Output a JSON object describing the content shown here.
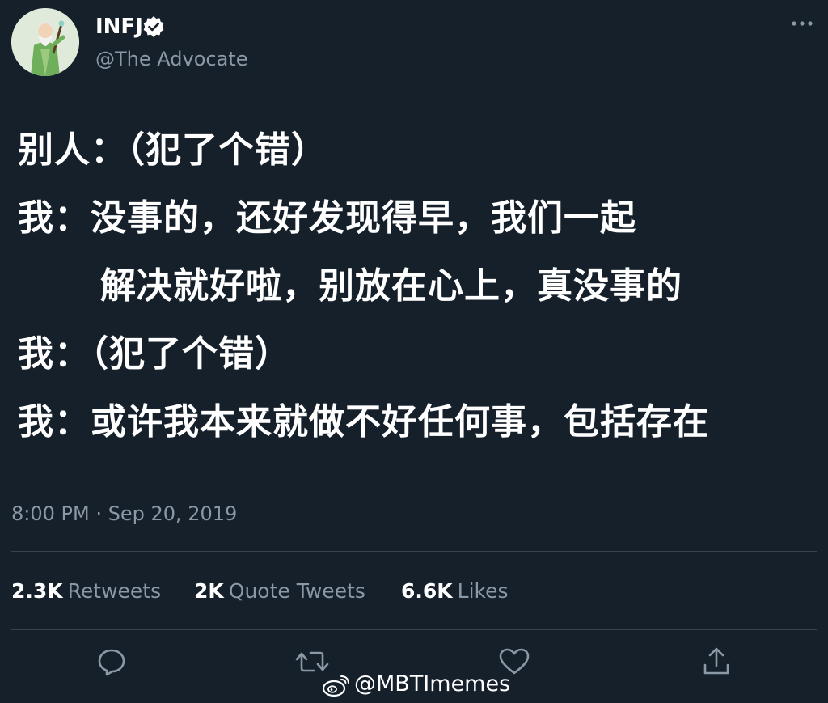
{
  "author": {
    "display_name": "INFJ",
    "handle": "@The Advocate",
    "avatar_icon": "advocate-character-avatar",
    "verified_icon": "verified-badge-icon"
  },
  "tweet": {
    "lines": [
      "别人：（犯了个错）",
      "我：没事的，还好发现得早，我们一起",
      "解决就好啦，别放在心上，真没事的",
      "我：（犯了个错）",
      "我：或许我本来就做不好任何事，包括存在"
    ],
    "timestamp": "8:00 PM · Sep 20, 2019"
  },
  "stats": {
    "retweets_count": "2.3K",
    "retweets_label": "Retweets",
    "quotes_count": "2K",
    "quotes_label": "Quote Tweets",
    "likes_count": "6.6K",
    "likes_label": "Likes"
  },
  "actions": [
    "reply-icon",
    "retweet-icon",
    "like-icon",
    "share-icon"
  ],
  "watermark": {
    "text": "@MBTImemes",
    "icon": "weibo-logo-icon"
  },
  "colors": {
    "background": "#15202b",
    "text_primary": "#ffffff",
    "text_secondary": "#8b98a5",
    "divider": "#38444d"
  }
}
